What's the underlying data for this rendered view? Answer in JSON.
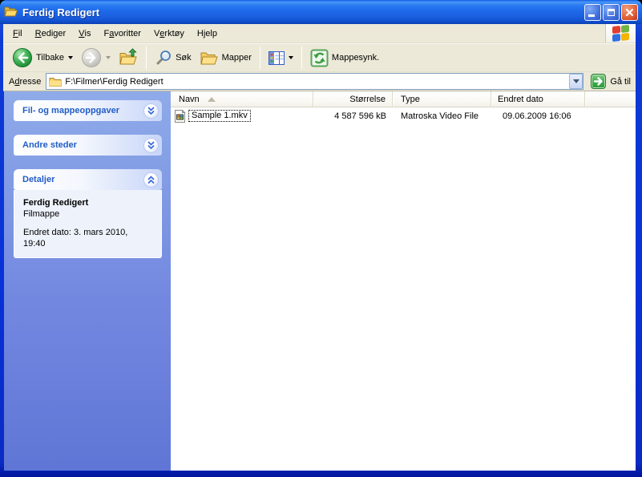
{
  "colors": {
    "border-blue": "#0831d9",
    "accent-blue": "#215dc6",
    "sidebar-top": "#8fabe9",
    "sidebar-bottom": "#6076d6",
    "panel-body": "#edf2fb",
    "toolbar-bg": "#ece9d8",
    "close-red": "#d14224",
    "go-green": "#2b9839"
  },
  "window": {
    "title": "Ferdig Redigert"
  },
  "menu": {
    "items": [
      {
        "label": "Fil",
        "accel": 0
      },
      {
        "label": "Rediger",
        "accel": 0
      },
      {
        "label": "Vis",
        "accel": 0
      },
      {
        "label": "Favoritter",
        "accel": 1
      },
      {
        "label": "Verktøy",
        "accel": 1
      },
      {
        "label": "Hjelp",
        "accel": 1
      }
    ]
  },
  "toolbar": {
    "back_label": "Tilbake",
    "search_label": "Søk",
    "folders_label": "Mapper",
    "sync_label": "Mappesynk."
  },
  "addressbar": {
    "label": {
      "label": "Adresse",
      "accel": 1
    },
    "value": "F:\\Filmer\\Ferdig Redigert",
    "go_label": "Gå til"
  },
  "sidebar": {
    "panels": [
      {
        "title": "Fil- og mappeoppgaver",
        "state": "collapsed"
      },
      {
        "title": "Andre steder",
        "state": "collapsed"
      },
      {
        "title": "Detaljer",
        "state": "expanded"
      }
    ],
    "details": {
      "name": "Ferdig Redigert",
      "type": "Filmappe",
      "modified": "Endret dato: 3. mars 2010, 19:40"
    }
  },
  "filelist": {
    "columns": [
      {
        "label": "Navn",
        "sorted": "asc"
      },
      {
        "label": "Størrelse"
      },
      {
        "label": "Type"
      },
      {
        "label": "Endret dato"
      }
    ],
    "rows": [
      {
        "name": "Sample 1.mkv",
        "size": "4 587 596 kB",
        "type": "Matroska Video File",
        "modified": "09.06.2009 16:06",
        "selected": true
      }
    ]
  },
  "icons": [
    "folder-open-icon",
    "minimize-icon",
    "maximize-icon",
    "close-icon",
    "windows-logo-icon",
    "back-icon",
    "forward-icon",
    "folder-up-icon",
    "search-icon",
    "folders-icon",
    "views-icon",
    "folder-sync-icon",
    "address-folder-icon",
    "dropdown-chevron-icon",
    "go-arrow-icon",
    "chevron-double-down-icon",
    "chevron-double-up-icon",
    "sort-ascending-icon",
    "video-file-icon"
  ]
}
